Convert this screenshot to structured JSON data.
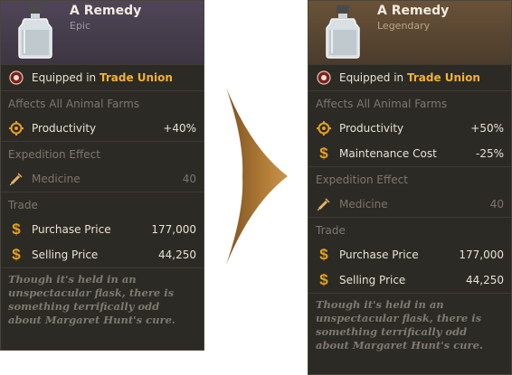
{
  "left_card": {
    "title": "A Remedy",
    "rarity": "Epic",
    "equipped_prefix": "Equipped in",
    "equipped_location": "Trade Union",
    "affects_title": "Affects All Animal Farms",
    "productivity_label": "Productivity",
    "productivity_value": "+40%",
    "expedition_title": "Expedition Effect",
    "medicine_label": "Medicine",
    "medicine_value": "40",
    "trade_title": "Trade",
    "purchase_label": "Purchase Price",
    "purchase_value": "177,000",
    "selling_label": "Selling Price",
    "selling_value": "44,250",
    "flavor": "Though it's held in an unspectacular flask, there is something terrifically odd about Margaret Hunt's cure."
  },
  "right_card": {
    "title": "A Remedy",
    "rarity": "Legendary",
    "equipped_prefix": "Equipped in",
    "equipped_location": "Trade Union",
    "affects_title": "Affects All Animal Farms",
    "productivity_label": "Productivity",
    "productivity_value": "+50%",
    "maintenance_label": "Maintenance Cost",
    "maintenance_value": "-25%",
    "expedition_title": "Expedition Effect",
    "medicine_label": "Medicine",
    "medicine_value": "40",
    "trade_title": "Trade",
    "purchase_label": "Purchase Price",
    "purchase_value": "177,000",
    "selling_label": "Selling Price",
    "selling_value": "44,250",
    "flavor": "Though it's held in an unspectacular flask, there is something terrifically odd about Margaret Hunt's cure."
  },
  "icons": {
    "flask": "flask-icon",
    "guild": "trade-union-emblem-icon",
    "productivity": "gear-icon",
    "medicine": "syringe-icon",
    "currency": "dollar-icon",
    "transition": "arrow-right-icon"
  },
  "colors": {
    "highlight": "#f2b233",
    "epic_header": "#4f4557",
    "legendary_header": "#6a5238",
    "arrow": "#a9742f"
  },
  "currency_symbol": "$"
}
